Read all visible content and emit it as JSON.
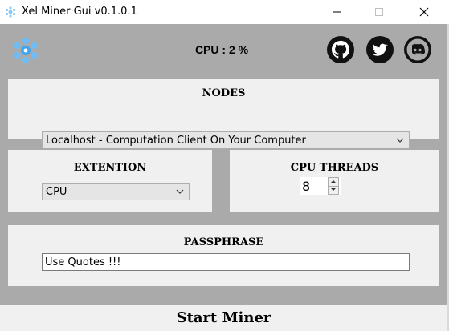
{
  "window": {
    "title": "Xel Miner Gui v0.1.0.1",
    "controls": [
      "minimize-icon",
      "maximize-icon",
      "close-icon"
    ]
  },
  "header": {
    "logo_icon": "xel-logo-icon",
    "cpu_status": "CPU : 2 %",
    "social": [
      "github-icon",
      "twitter-icon",
      "discord-icon"
    ]
  },
  "nodes": {
    "title": "NODES",
    "selected": "Localhost - Computation Client On Your Computer"
  },
  "extension": {
    "title": "EXTENTION",
    "selected": "CPU"
  },
  "cpu_threads": {
    "title": "CPU THREADS",
    "value": "8"
  },
  "passphrase": {
    "title": "PASSPHRASE",
    "value": "Use Quotes !!!"
  },
  "actions": {
    "start_label": "Start Miner"
  },
  "colors": {
    "background": "#aaaaaa",
    "panel": "#f0f0f0",
    "accent_logo": "#3da5f4"
  }
}
